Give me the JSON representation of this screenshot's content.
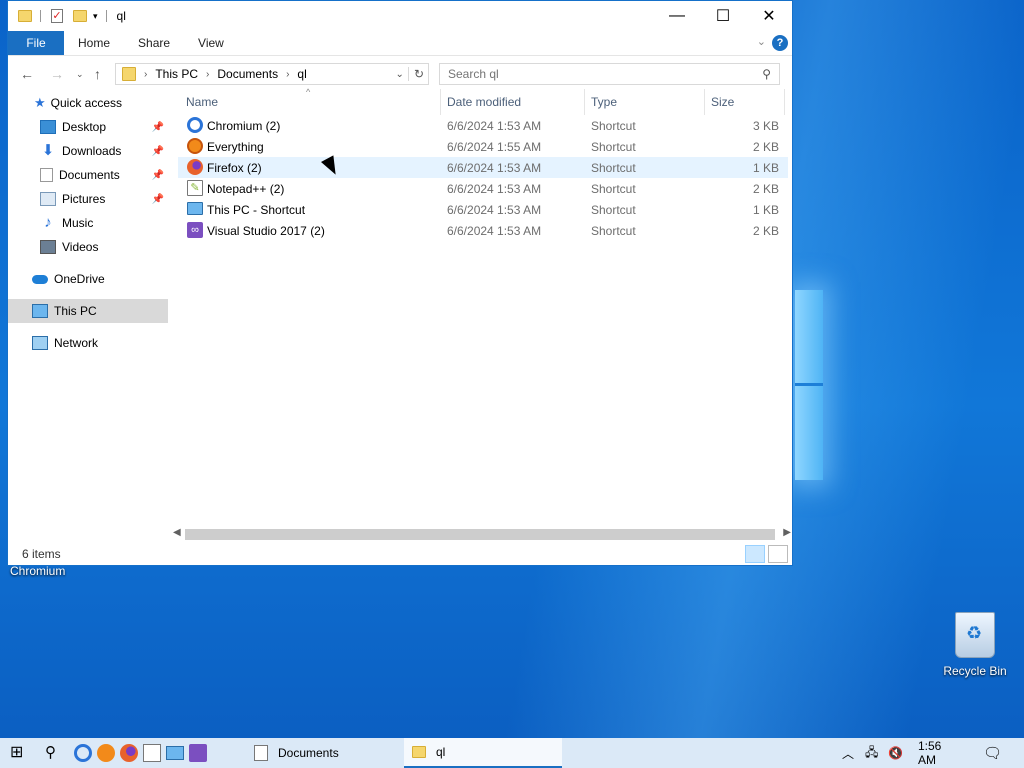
{
  "window": {
    "title": "ql",
    "controls": {
      "minimize": "—",
      "maximize": "☐",
      "close": "✕"
    }
  },
  "ribbon": {
    "tabs": [
      "File",
      "Home",
      "Share",
      "View"
    ],
    "help": "?"
  },
  "address": {
    "crumbs": [
      "This PC",
      "Documents",
      "ql"
    ],
    "search_placeholder": "Search ql"
  },
  "navigation": {
    "quick_access": "Quick access",
    "items": [
      {
        "label": "Desktop",
        "pinned": true
      },
      {
        "label": "Downloads",
        "pinned": true
      },
      {
        "label": "Documents",
        "pinned": true
      },
      {
        "label": "Pictures",
        "pinned": true
      },
      {
        "label": "Music",
        "pinned": false
      },
      {
        "label": "Videos",
        "pinned": false
      }
    ],
    "onedrive": "OneDrive",
    "this_pc": "This PC",
    "network": "Network"
  },
  "columns": [
    "Name",
    "Date modified",
    "Type",
    "Size"
  ],
  "files": [
    {
      "name": "Chromium (2)",
      "date": "6/6/2024 1:53 AM",
      "type": "Shortcut",
      "size": "3 KB",
      "icon": "chromium-icon",
      "color": "#2b74d8"
    },
    {
      "name": "Everything",
      "date": "6/6/2024 1:55 AM",
      "type": "Shortcut",
      "size": "2 KB",
      "icon": "everything-icon",
      "color": "#f28a1a"
    },
    {
      "name": "Firefox (2)",
      "date": "6/6/2024 1:53 AM",
      "type": "Shortcut",
      "size": "1 KB",
      "icon": "firefox-icon",
      "color": "#e8622c"
    },
    {
      "name": "Notepad++ (2)",
      "date": "6/6/2024 1:53 AM",
      "type": "Shortcut",
      "size": "2 KB",
      "icon": "notepadpp-icon",
      "color": "#88b83a"
    },
    {
      "name": "This PC - Shortcut",
      "date": "6/6/2024 1:53 AM",
      "type": "Shortcut",
      "size": "1 KB",
      "icon": "computer-icon",
      "color": "#3a8fd6"
    },
    {
      "name": "Visual Studio 2017 (2)",
      "date": "6/6/2024 1:53 AM",
      "type": "Shortcut",
      "size": "2 KB",
      "icon": "visual-studio-icon",
      "color": "#7b4fc0"
    }
  ],
  "status": {
    "items_count": "6 items"
  },
  "desktop": {
    "chromium_label": "Chromium",
    "recycle_bin": "Recycle Bin"
  },
  "taskbar": {
    "tasks": [
      {
        "label": "Documents",
        "active": false
      },
      {
        "label": "ql",
        "active": true
      }
    ],
    "clock": "1:56 AM"
  }
}
